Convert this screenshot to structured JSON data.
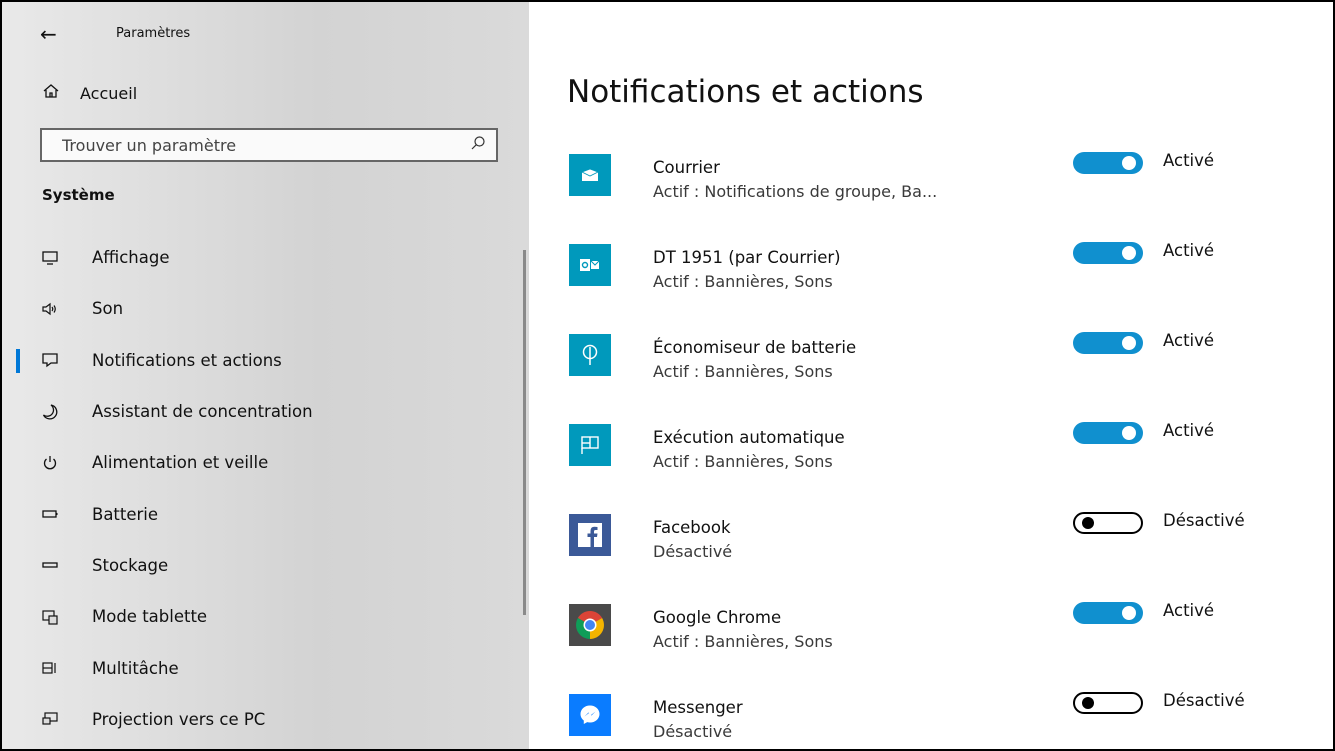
{
  "window": {
    "title": "Paramètres",
    "back_icon": "back-arrow-icon"
  },
  "sidebar": {
    "home_label": "Accueil",
    "search_placeholder": "Trouver un paramètre",
    "section_title": "Système",
    "active_item": "Notifications et actions",
    "items": [
      {
        "label": "Affichage",
        "icon": "display-icon"
      },
      {
        "label": "Son",
        "icon": "speaker-icon"
      },
      {
        "label": "Notifications et actions",
        "icon": "notification-icon"
      },
      {
        "label": "Assistant de concentration",
        "icon": "moon-icon"
      },
      {
        "label": "Alimentation et veille",
        "icon": "power-icon"
      },
      {
        "label": "Batterie",
        "icon": "battery-icon"
      },
      {
        "label": "Stockage",
        "icon": "storage-icon"
      },
      {
        "label": "Mode tablette",
        "icon": "tablet-mode-icon"
      },
      {
        "label": "Multitâche",
        "icon": "multitask-icon"
      },
      {
        "label": "Projection vers ce PC",
        "icon": "projection-icon"
      }
    ]
  },
  "main": {
    "title": "Notifications et actions",
    "apps": [
      {
        "name": "Courrier",
        "status": "Actif : Notifications de groupe, Ba...",
        "enabled": true,
        "toggle_label": "Activé",
        "icon": "mail-icon",
        "color": "#0099bc"
      },
      {
        "name": "DT 1951 (par Courrier)",
        "status": "Actif : Bannières, Sons",
        "enabled": true,
        "toggle_label": "Activé",
        "icon": "outlook-icon",
        "color": "#0099bc"
      },
      {
        "name": "Économiseur de batterie",
        "status": "Actif : Bannières, Sons",
        "enabled": true,
        "toggle_label": "Activé",
        "icon": "leaf-icon",
        "color": "#0099bc"
      },
      {
        "name": "Exécution automatique",
        "status": "Actif : Bannières, Sons",
        "enabled": true,
        "toggle_label": "Activé",
        "icon": "autoplay-icon",
        "color": "#0099bc"
      },
      {
        "name": "Facebook",
        "status": "Désactivé",
        "enabled": false,
        "toggle_label": "Désactivé",
        "icon": "facebook-icon",
        "color": "#3b5998"
      },
      {
        "name": "Google Chrome",
        "status": "Actif : Bannières, Sons",
        "enabled": true,
        "toggle_label": "Activé",
        "icon": "chrome-icon",
        "color": "#4a4a4a"
      },
      {
        "name": "Messenger",
        "status": "Désactivé",
        "enabled": false,
        "toggle_label": "Désactivé",
        "icon": "messenger-icon",
        "color": "#0a7cff"
      }
    ]
  },
  "colors": {
    "accent": "#0078d7",
    "toggle_on": "#1090cf",
    "app_tile": "#0099bc"
  }
}
